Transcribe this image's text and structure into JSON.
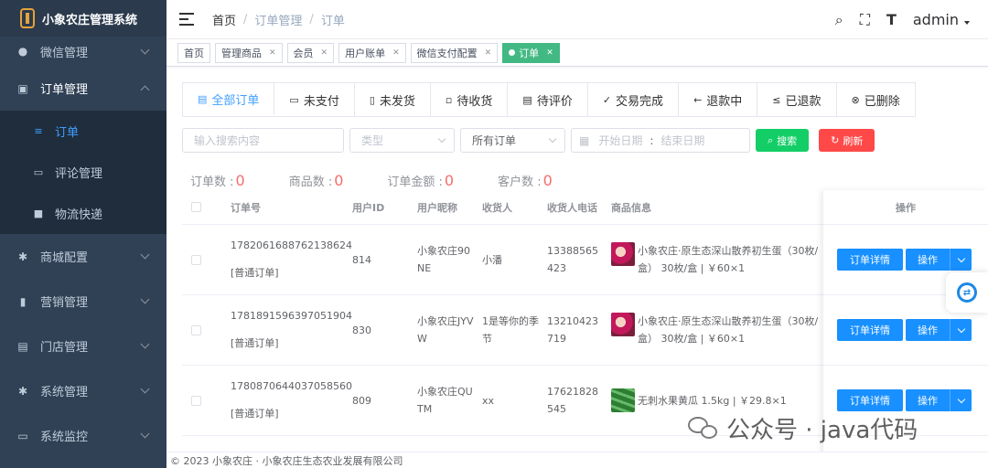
{
  "app": {
    "title": "小象农庄管理系统"
  },
  "sidebar": {
    "items": [
      {
        "label": "微信管理",
        "icon": "wechat-icon"
      },
      {
        "label": "订单管理",
        "icon": "lock-icon",
        "open": true
      },
      {
        "label": "商城配置",
        "icon": "gear-icon"
      },
      {
        "label": "营销管理",
        "icon": "chart-icon"
      },
      {
        "label": "门店管理",
        "icon": "store-icon"
      },
      {
        "label": "系统管理",
        "icon": "gear-icon"
      },
      {
        "label": "系统监控",
        "icon": "monitor-icon"
      }
    ],
    "sub_items": [
      {
        "label": "订单",
        "icon": "order-icon",
        "active": true
      },
      {
        "label": "评论管理",
        "icon": "comment-icon"
      },
      {
        "label": "物流快递",
        "icon": "truck-icon"
      }
    ]
  },
  "header": {
    "breadcrumb": [
      "首页",
      "订单管理",
      "订单"
    ],
    "user": "admin"
  },
  "tags": [
    {
      "label": "首页"
    },
    {
      "label": "管理商品"
    },
    {
      "label": "会员"
    },
    {
      "label": "用户账单"
    },
    {
      "label": "微信支付配置"
    },
    {
      "label": "订单",
      "active": true
    }
  ],
  "tabs": [
    {
      "label": "全部订单",
      "icon": "doc-icon",
      "active": true
    },
    {
      "label": "未支付",
      "icon": "card-icon"
    },
    {
      "label": "未发货",
      "icon": "box-icon"
    },
    {
      "label": "待收货",
      "icon": "truck-icon"
    },
    {
      "label": "待评价",
      "icon": "edit-icon"
    },
    {
      "label": "交易完成",
      "icon": "check-circle-icon"
    },
    {
      "label": "退款中",
      "icon": "arrow-left-icon"
    },
    {
      "label": "已退款",
      "icon": "refund-icon"
    },
    {
      "label": "已删除",
      "icon": "delete-circle-icon"
    }
  ],
  "filters": {
    "search_placeholder": "输入搜索内容",
    "type_placeholder": "类型",
    "order_scope": "所有订单",
    "start_placeholder": "开始日期",
    "date_sep": ":",
    "end_placeholder": "结束日期",
    "search_btn": "搜索",
    "refresh_btn": "刷新"
  },
  "stats": [
    {
      "label": "订单数 :",
      "value": "0"
    },
    {
      "label": "商品数 :",
      "value": "0"
    },
    {
      "label": "订单金额 :",
      "value": "0"
    },
    {
      "label": "客户数 :",
      "value": "0"
    }
  ],
  "table": {
    "headers": [
      "订单号",
      "用户ID",
      "用户昵称",
      "收货人",
      "收货人电话",
      "商品信息",
      "操作"
    ],
    "rows": [
      {
        "order_no": "1782061688762138624",
        "order_type": "[普通订单]",
        "uid": "814",
        "nick": "小象农庄90NE",
        "receiver": "小潘",
        "phone": "13388565423",
        "goods": "小象农庄·原生态深山散养初生蛋（30枚/盒） 30枚/盒 | ￥60×1",
        "img": "egg"
      },
      {
        "order_no": "1781891596397051904",
        "order_type": "[普通订单]",
        "uid": "830",
        "nick": "小象农庄JYVW",
        "receiver": "1是等你的季节",
        "phone": "13210423719",
        "goods": "小象农庄·原生态深山散养初生蛋（30枚/盒） 30枚/盒 | ￥60×1",
        "img": "egg"
      },
      {
        "order_no": "1780870644037058560",
        "order_type": "[普通订单]",
        "uid": "809",
        "nick": "小象农庄QUTM",
        "receiver": "xx",
        "phone": "17621828545",
        "goods": "无刺水果黄瓜 1.5kg | ￥29.8×1",
        "img": "cuc"
      }
    ],
    "detail_btn": "订单详情",
    "op_btn": "操作"
  },
  "footer": "© 2023 小象农庄 · 小象农庄生态农业发展有限公司",
  "watermark": "公众号 · java代码"
}
